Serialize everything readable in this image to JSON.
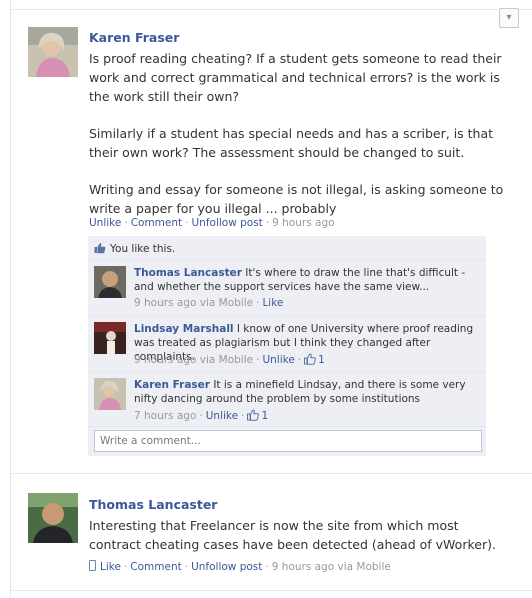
{
  "posts": [
    {
      "author": "Karen Fraser",
      "paragraphs": [
        "Is proof reading cheating? If a student gets someone to read their work and correct grammatical and technical errors? is the work is the work still their own?",
        "Similarly if a student has special needs and has a scriber, is that their own work? The assessment should be changed to suit.",
        "Writing and essay for someone is not illegal, is asking someone to write a paper for you illegal ... probably"
      ],
      "actions": {
        "unlike": "Unlike",
        "comment": "Comment",
        "unfollow": "Unfollow post",
        "time": "9 hours ago"
      },
      "likes_text": "You like this.",
      "comments": [
        {
          "author": "Thomas Lancaster",
          "text": "It's where to draw the line that's difficult - and whether the support services have the same view...",
          "time": "9 hours ago via Mobile",
          "action": "Like",
          "like_count": ""
        },
        {
          "author": "Lindsay Marshall",
          "text": "I know of one University where proof reading was treated as plagiarism but I think they changed after complaints.",
          "time": "9 hours ago via Mobile",
          "action": "Unlike",
          "like_count": "1"
        },
        {
          "author": "Karen Fraser",
          "text": "It is a minefield Lindsay, and there is some very nifty dancing around the problem by some institutions",
          "time": "7 hours ago",
          "action": "Unlike",
          "like_count": "1"
        }
      ],
      "comment_placeholder": "Write a comment..."
    },
    {
      "author": "Thomas Lancaster",
      "paragraphs": [
        "Interesting that Freelancer is now the site from which most contract cheating cases have been detected (ahead of vWorker)."
      ],
      "actions": {
        "like": "Like",
        "comment": "Comment",
        "unfollow": "Unfollow post",
        "time": "9 hours ago via Mobile"
      }
    }
  ],
  "icons": {
    "menu": "chevron-down-icon",
    "like": "thumbs-up-icon",
    "mobile": "mobile-phone-icon"
  },
  "colors": {
    "link": "#3b5998",
    "meta": "#999999",
    "comment_bg": "#edeff4"
  }
}
